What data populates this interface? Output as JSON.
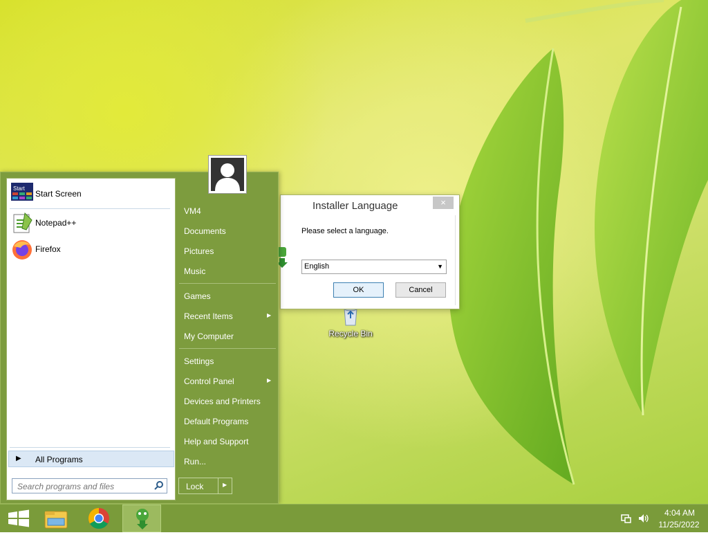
{
  "desktop": {
    "icons": [
      {
        "label": "Recycle Bin",
        "icon": "recycle-bin-icon"
      }
    ]
  },
  "dialog": {
    "title": "Installer Language",
    "close_label": "×",
    "prompt": "Please select a language.",
    "language_value": "English",
    "ok_label": "OK",
    "cancel_label": "Cancel"
  },
  "start_menu": {
    "pinned": [
      {
        "label": "Start Screen",
        "icon": "start-screen-icon",
        "tile_text": "Start"
      },
      {
        "label": "Notepad++",
        "icon": "notepad-plus-plus-icon"
      },
      {
        "label": "Firefox",
        "icon": "firefox-icon"
      }
    ],
    "all_programs_label": "All Programs",
    "search_placeholder": "Search programs and files",
    "right_items": [
      {
        "label": "VM4"
      },
      {
        "label": "Documents"
      },
      {
        "label": "Pictures"
      },
      {
        "label": "Music"
      },
      {
        "label": "Games"
      },
      {
        "label": "Recent Items",
        "has_submenu": true
      },
      {
        "label": "My Computer"
      },
      {
        "label": "Settings"
      },
      {
        "label": "Control Panel",
        "has_submenu": true
      },
      {
        "label": "Devices and Printers"
      },
      {
        "label": "Default Programs"
      },
      {
        "label": "Help and Support"
      },
      {
        "label": "Run..."
      }
    ],
    "lock_label": "Lock"
  },
  "taskbar": {
    "buttons": [
      {
        "icon": "windows-start-icon"
      },
      {
        "icon": "file-explorer-icon"
      },
      {
        "icon": "chrome-icon"
      },
      {
        "icon": "nsis-installer-icon",
        "active": true
      }
    ],
    "tray": {
      "icons": [
        "network-icon",
        "volume-icon"
      ],
      "time": "4:04 AM",
      "date": "11/25/2022"
    }
  },
  "colors": {
    "accent": "#7d9c3e",
    "taskbar": "#7a9b3a"
  }
}
